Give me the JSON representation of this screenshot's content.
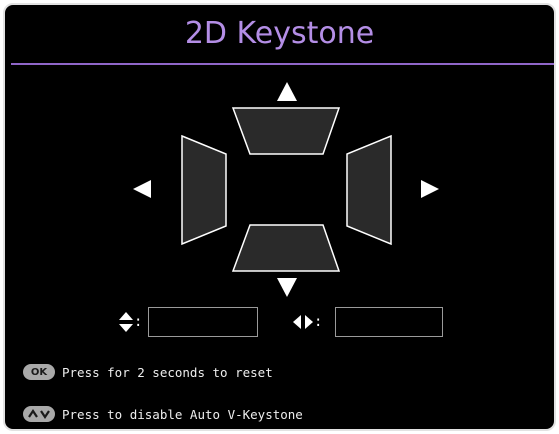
{
  "title": "2D Keystone",
  "vertical_value": "",
  "horizontal_value": "",
  "colon": ":",
  "hints": [
    {
      "key": "OK",
      "text": "Press for 2 seconds to reset"
    },
    {
      "key": "up-down",
      "text": "Press to disable Auto V-Keystone"
    }
  ],
  "colors": {
    "title": "#b48ee6",
    "divider": "#8f66c8",
    "trapezoid_fill": "#2a2a2a",
    "outline": "#ffffff"
  }
}
